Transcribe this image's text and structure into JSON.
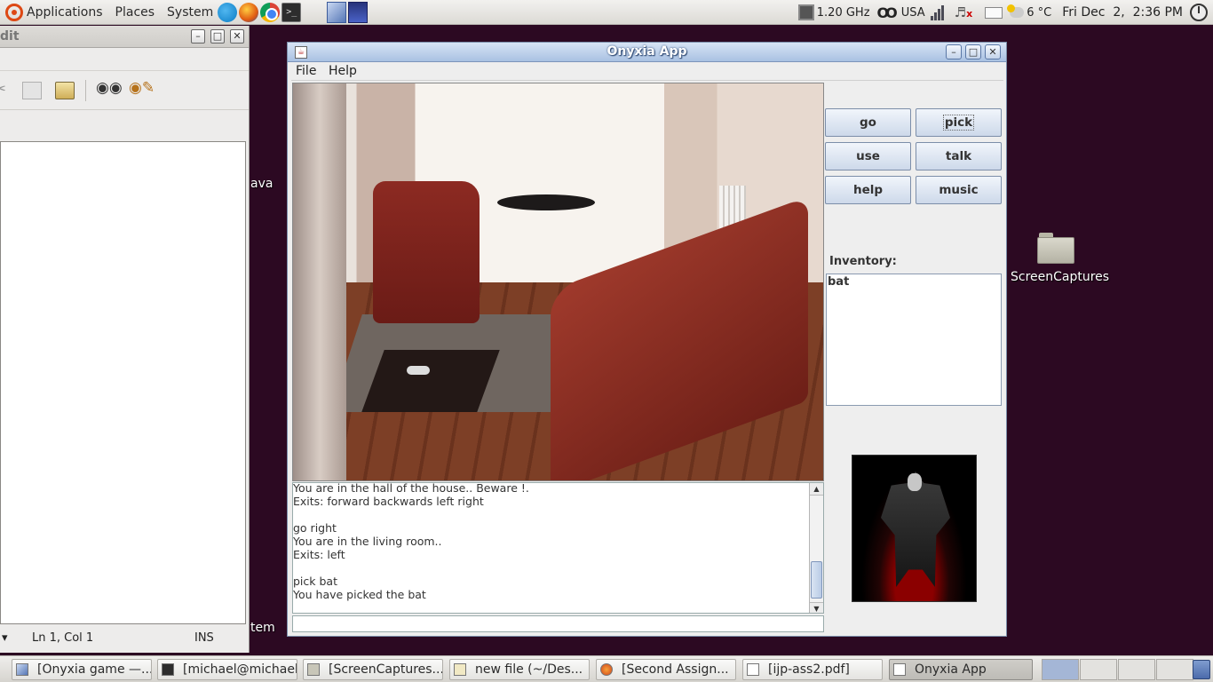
{
  "top_panel": {
    "menus": [
      "Applications",
      "Places",
      "System"
    ],
    "launchers": [
      "skype-icon",
      "firefox-icon",
      "chrome-icon",
      "terminal-icon"
    ],
    "cpu_freq": "1.20 GHz",
    "keyboard_layout": "USA",
    "weather": "6 °C",
    "clock": "Fri Dec  2,  2:36 PM"
  },
  "desktop": {
    "partial_label_1": "ava",
    "partial_label_2": "tem",
    "folder_label": "ScreenCaptures"
  },
  "editor": {
    "title_fragment": "dit",
    "status_arrow": "▾",
    "status_position": "Ln 1, Col 1",
    "status_mode": "INS"
  },
  "app": {
    "title": "Onyxia App",
    "menu": {
      "file": "File",
      "help": "Help"
    },
    "buttons": {
      "go": "go",
      "pick": "pick",
      "use": "use",
      "talk": "talk",
      "help": "help",
      "music": "music"
    },
    "inventory_label": "Inventory:",
    "inventory_items": "bat",
    "console_lines": "You are in the hall of the house.. Beware !.\nExits: forward backwards left right\n\ngo right\nYou are in the living room..\nExits: left\n\npick bat\nYou have picked the bat",
    "command_input_value": ""
  },
  "taskbar": {
    "tasks": [
      "[Onyxia game —...",
      "[michael@michael...",
      "[ScreenCaptures...",
      "new file (~/Des...",
      "[Second Assign...",
      "[ijp-ass2.pdf]",
      "Onyxia App"
    ]
  }
}
